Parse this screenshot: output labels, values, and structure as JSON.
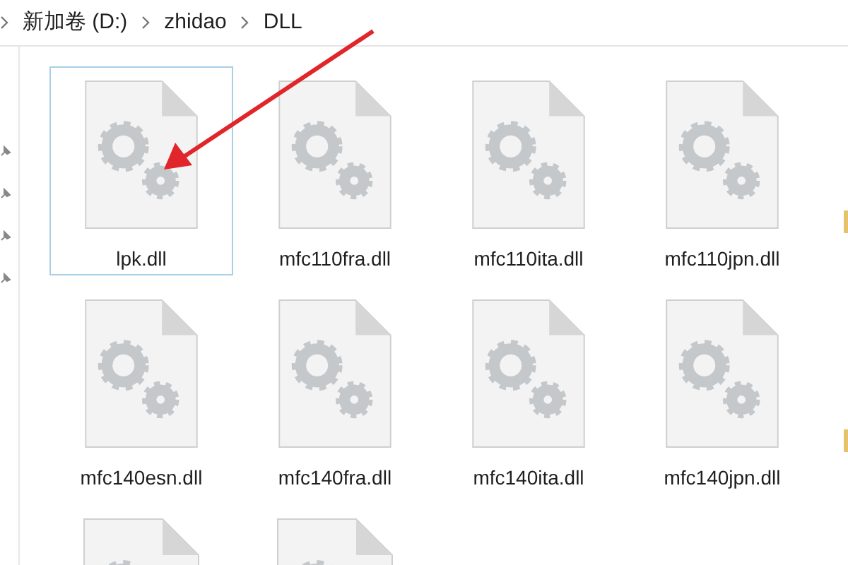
{
  "breadcrumb": [
    "新加卷 (D:)",
    "zhidao",
    "DLL"
  ],
  "files": [
    {
      "kind": "dll",
      "name": "lpk.dll",
      "selected": true
    },
    {
      "kind": "dll",
      "name": "mfc110fra.dll",
      "selected": false
    },
    {
      "kind": "dll",
      "name": "mfc110ita.dll",
      "selected": false
    },
    {
      "kind": "dll",
      "name": "mfc110jpn.dll",
      "selected": false
    },
    {
      "kind": "cut",
      "selected": false
    },
    {
      "kind": "dll",
      "name": "mfc140esn.dll",
      "selected": false
    },
    {
      "kind": "dll",
      "name": "mfc140fra.dll",
      "selected": false
    },
    {
      "kind": "dll",
      "name": "mfc140ita.dll",
      "selected": false
    },
    {
      "kind": "dll",
      "name": "mfc140jpn.dll",
      "selected": false
    },
    {
      "kind": "cut",
      "selected": false
    },
    {
      "kind": "dll",
      "selected": false
    },
    {
      "kind": "dll",
      "selected": false
    }
  ]
}
